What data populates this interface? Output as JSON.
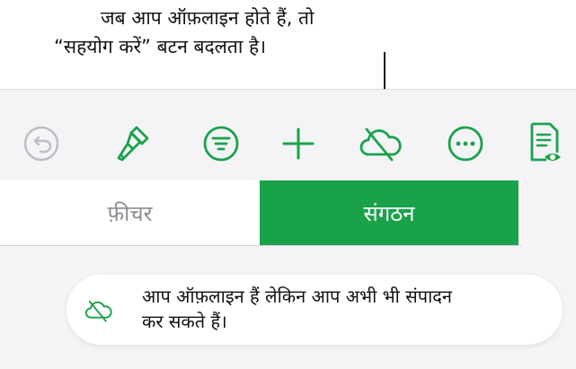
{
  "callout": {
    "line1": "जब आप ऑफ़लाइन होते हैं, तो",
    "line2": "“सहयोग करें” बटन बदलता है।"
  },
  "toolbar": {
    "icons": {
      "undo": "undo-icon",
      "format": "paintbrush-icon",
      "organize": "list-filter-icon",
      "insert": "plus-icon",
      "collaborate": "cloud-offline-icon",
      "more": "ellipsis-icon",
      "view": "document-view-icon"
    }
  },
  "segmented": {
    "features_label": "फ़ीचर",
    "organize_label": "संगठन"
  },
  "toast": {
    "line1": "आप ऑफ़लाइन हैं लेकिन आप अभी भी संपादन",
    "line2": "कर सकते हैं।"
  },
  "colors": {
    "accent": "#1aa24b",
    "disabled": "#bdbdc2",
    "panel_bg": "#f4f4f6"
  }
}
